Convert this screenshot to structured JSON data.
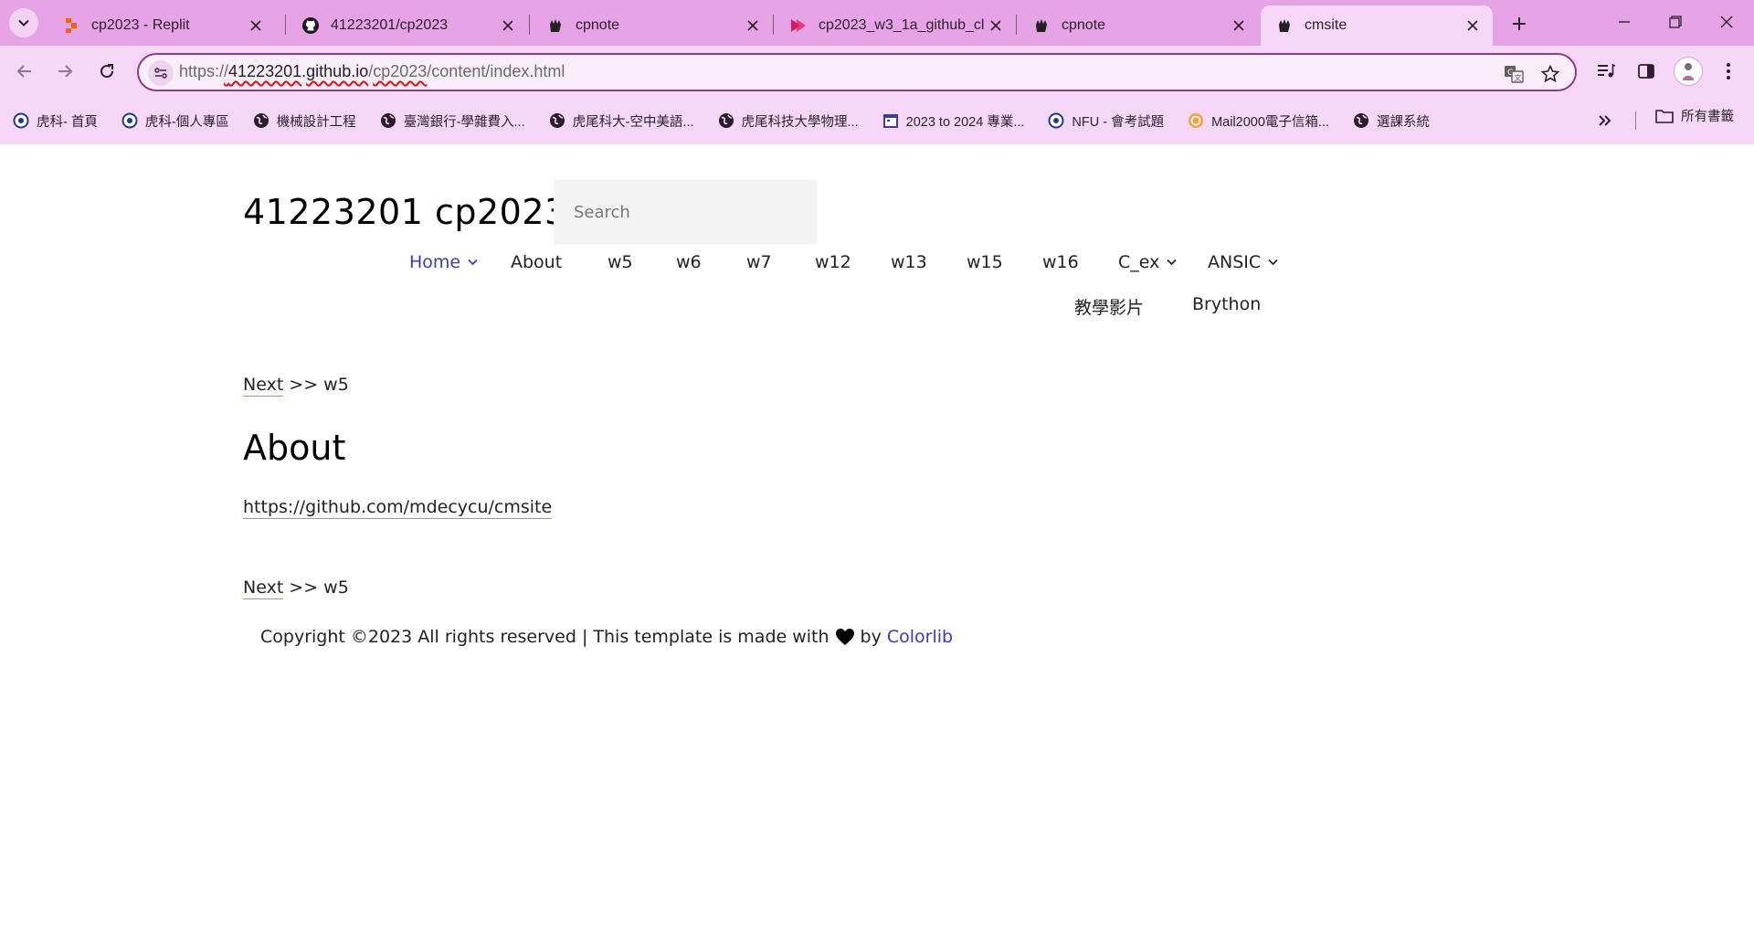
{
  "browser": {
    "tabs": [
      {
        "title": "cp2023 - Replit",
        "icon": "replit-icon",
        "active": false
      },
      {
        "title": "41223201/cp2023",
        "icon": "github-icon",
        "active": false
      },
      {
        "title": "cpnote",
        "icon": "hand-icon",
        "active": false
      },
      {
        "title": "cp2023_w3_1a_github_cl",
        "icon": "video-icon",
        "active": false
      },
      {
        "title": "cpnote",
        "icon": "hand-icon",
        "active": false
      },
      {
        "title": "cmsite",
        "icon": "hand-icon",
        "active": true
      }
    ],
    "url": {
      "scheme": "https:/",
      "slash": "/",
      "user": "41223201",
      "dot": ".",
      "host": "github.io",
      "slash2": "/",
      "repo": "cp2023",
      "path": "/content/index.html"
    },
    "bookmarks": [
      {
        "label": "虎科- 首頁",
        "icon": "nfu-icon"
      },
      {
        "label": "虎科-個人專區",
        "icon": "nfu-icon"
      },
      {
        "label": "機械設計工程",
        "icon": "globe-icon"
      },
      {
        "label": "臺灣銀行-學雜費入...",
        "icon": "globe-icon"
      },
      {
        "label": "虎尾科大-空中美語...",
        "icon": "globe-icon"
      },
      {
        "label": "虎尾科技大學物理...",
        "icon": "globe-icon"
      },
      {
        "label": "2023 to 2024 專業...",
        "icon": "calendar-icon"
      },
      {
        "label": "NFU - 會考試題",
        "icon": "nfu-icon"
      },
      {
        "label": "Mail2000電子信箱...",
        "icon": "mail-icon"
      },
      {
        "label": "選課系統",
        "icon": "globe-icon"
      }
    ],
    "bookmarks_folder": "所有書籤"
  },
  "site": {
    "title": "41223201 cp2023",
    "search_placeholder": "Search",
    "menu": {
      "home": "Home",
      "about": "About",
      "w5": "w5",
      "w6": "w6",
      "w7": "w7",
      "w12": "w12",
      "w13": "w13",
      "w15": "w15",
      "w16": "w16",
      "c_ex": "C_ex",
      "ansic": "ANSIC",
      "videos": "教學影片",
      "brython": "Brython"
    },
    "nav_top": {
      "next": "Next",
      "rest": " >> w5"
    },
    "heading": "About",
    "about_link": "https://github.com/mdecycu/cmsite",
    "nav_bottom": {
      "next": "Next",
      "rest": " >> w5"
    },
    "footer": {
      "pre": "Copyright ©2023 All rights reserved | This template is made with",
      "by": "by",
      "colorlib": "Colorlib"
    }
  }
}
